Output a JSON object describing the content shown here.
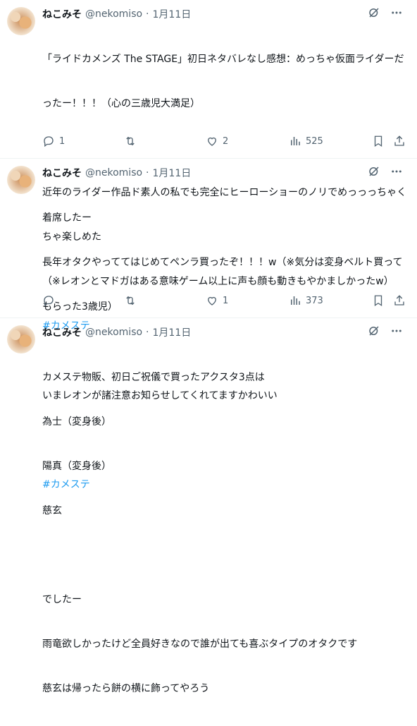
{
  "tweets": [
    {
      "name": "ねこみそ",
      "handle": "@nekomiso",
      "dot": "·",
      "date": "1月11日",
      "lines": [
        "「ライドカメンズ The STAGE」初日ネタバレなし感想：めっちゃ仮面ライダーだ",
        "ったー！！！（心の三歳児大満足）",
        "",
        "近年のライダー作品ド素人の私でも完全にヒーローショーのノリでめっっっちゃく",
        "ちゃ楽しめた",
        "（※レオンとマドガはある意味ゲーム以上に声も顔も動きもやかましかったw）"
      ],
      "hashtag": "#カメステ",
      "replies": "1",
      "retweets": "",
      "likes": "2",
      "views": "525"
    },
    {
      "name": "ねこみそ",
      "handle": "@nekomiso",
      "dot": "·",
      "date": "1月11日",
      "lines": [
        "着席したー",
        "長年オタクやっててはじめてペンラ買ったぞ！！！w（※気分は変身ベルト買って",
        "もらった3歳児）",
        "",
        "いまレオンが諸注意お知らせしてくれてますかわいい",
        ""
      ],
      "hashtag": "#カメステ",
      "replies": "",
      "retweets": "",
      "likes": "1",
      "views": "373"
    },
    {
      "name": "ねこみそ",
      "handle": "@nekomiso",
      "dot": "·",
      "date": "1月11日",
      "lines": [
        "カメステ物販、初日ご祝儀で買ったアクスタ3点は",
        "為士（変身後）",
        "陽真（変身後）",
        "慈玄",
        "",
        "でしたー",
        "雨竜欲しかったけど全員好きなので誰が出ても喜ぶタイプのオタクです",
        "慈玄は帰ったら餅の横に飾ってやろう"
      ]
    }
  ],
  "colors": {
    "text": "#0f1419",
    "muted": "#536471",
    "link": "#1d9bf0",
    "divider": "#eff3f4"
  },
  "icons": [
    "grok-icon",
    "more-icon",
    "reply-icon",
    "retweet-icon",
    "like-icon",
    "views-icon",
    "bookmark-icon",
    "share-icon"
  ]
}
